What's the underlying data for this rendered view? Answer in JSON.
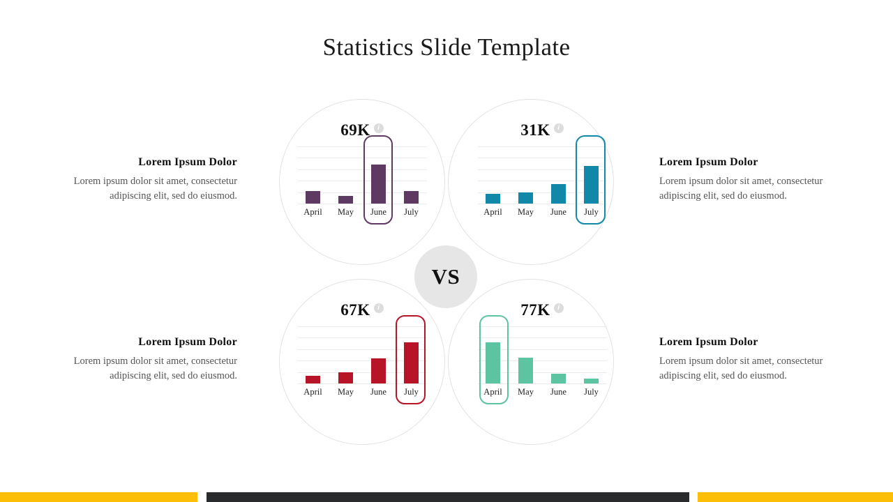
{
  "slide": {
    "title": "Statistics Slide Template",
    "vs_label": "VS",
    "info_glyph": "i"
  },
  "chart_data": [
    {
      "id": "top-left",
      "type": "bar",
      "title": "69K",
      "kpi": "69K",
      "color": "#5E3A63",
      "categories": [
        "April",
        "May",
        "June",
        "July"
      ],
      "values": [
        22,
        13,
        68,
        22
      ],
      "ylim": [
        0,
        100
      ],
      "highlight_index": 2,
      "grid": true,
      "gridlines": 6,
      "xlabel": "",
      "ylabel": "",
      "legend": "none"
    },
    {
      "id": "top-right",
      "type": "bar",
      "title": "31K",
      "kpi": "31K",
      "color": "#1188A8",
      "categories": [
        "April",
        "May",
        "June",
        "July"
      ],
      "values": [
        17,
        19,
        34,
        66
      ],
      "ylim": [
        0,
        100
      ],
      "highlight_index": 3,
      "grid": true,
      "gridlines": 6,
      "xlabel": "",
      "ylabel": "",
      "legend": "none"
    },
    {
      "id": "bottom-left",
      "type": "bar",
      "title": "67K",
      "kpi": "67K",
      "color": "#B81427",
      "categories": [
        "April",
        "May",
        "June",
        "July"
      ],
      "values": [
        14,
        20,
        44,
        72
      ],
      "ylim": [
        0,
        100
      ],
      "highlight_index": 3,
      "grid": true,
      "gridlines": 6,
      "xlabel": "",
      "ylabel": "",
      "legend": "none"
    },
    {
      "id": "bottom-right",
      "type": "bar",
      "title": "77K",
      "kpi": "77K",
      "color": "#5CC4A0",
      "categories": [
        "April",
        "May",
        "June",
        "July"
      ],
      "values": [
        72,
        45,
        17,
        9
      ],
      "ylim": [
        0,
        100
      ],
      "highlight_index": 0,
      "grid": true,
      "gridlines": 6,
      "xlabel": "",
      "ylabel": "",
      "legend": "none"
    }
  ],
  "items": [
    {
      "id": "item-1",
      "heading": "Lorem Ipsum Dolor",
      "body": "Lorem ipsum dolor sit amet, consectetur adipiscing elit, sed do eiusmod.",
      "icon": "user-gear-icon",
      "color": "#5E3A63"
    },
    {
      "id": "item-2",
      "heading": "Lorem Ipsum Dolor",
      "body": "Lorem ipsum dolor sit amet, consectetur adipiscing elit, sed do eiusmod.",
      "icon": "scales-icon",
      "color": "#1188A8"
    },
    {
      "id": "item-3",
      "heading": "Lorem Ipsum Dolor",
      "body": "Lorem ipsum dolor sit amet, consectetur adipiscing elit, sed do eiusmod.",
      "icon": "megaphone-icon",
      "color": "#B81427"
    },
    {
      "id": "item-4",
      "heading": "Lorem Ipsum Dolor",
      "body": "Lorem ipsum dolor sit amet, consectetur adipiscing elit, sed do eiusmod.",
      "icon": "strategy-clipboard-icon",
      "color": "#5CC4A0"
    }
  ],
  "footer": {
    "accent_yellow": "#FDBE07",
    "accent_dark": "#2A2B2D"
  }
}
